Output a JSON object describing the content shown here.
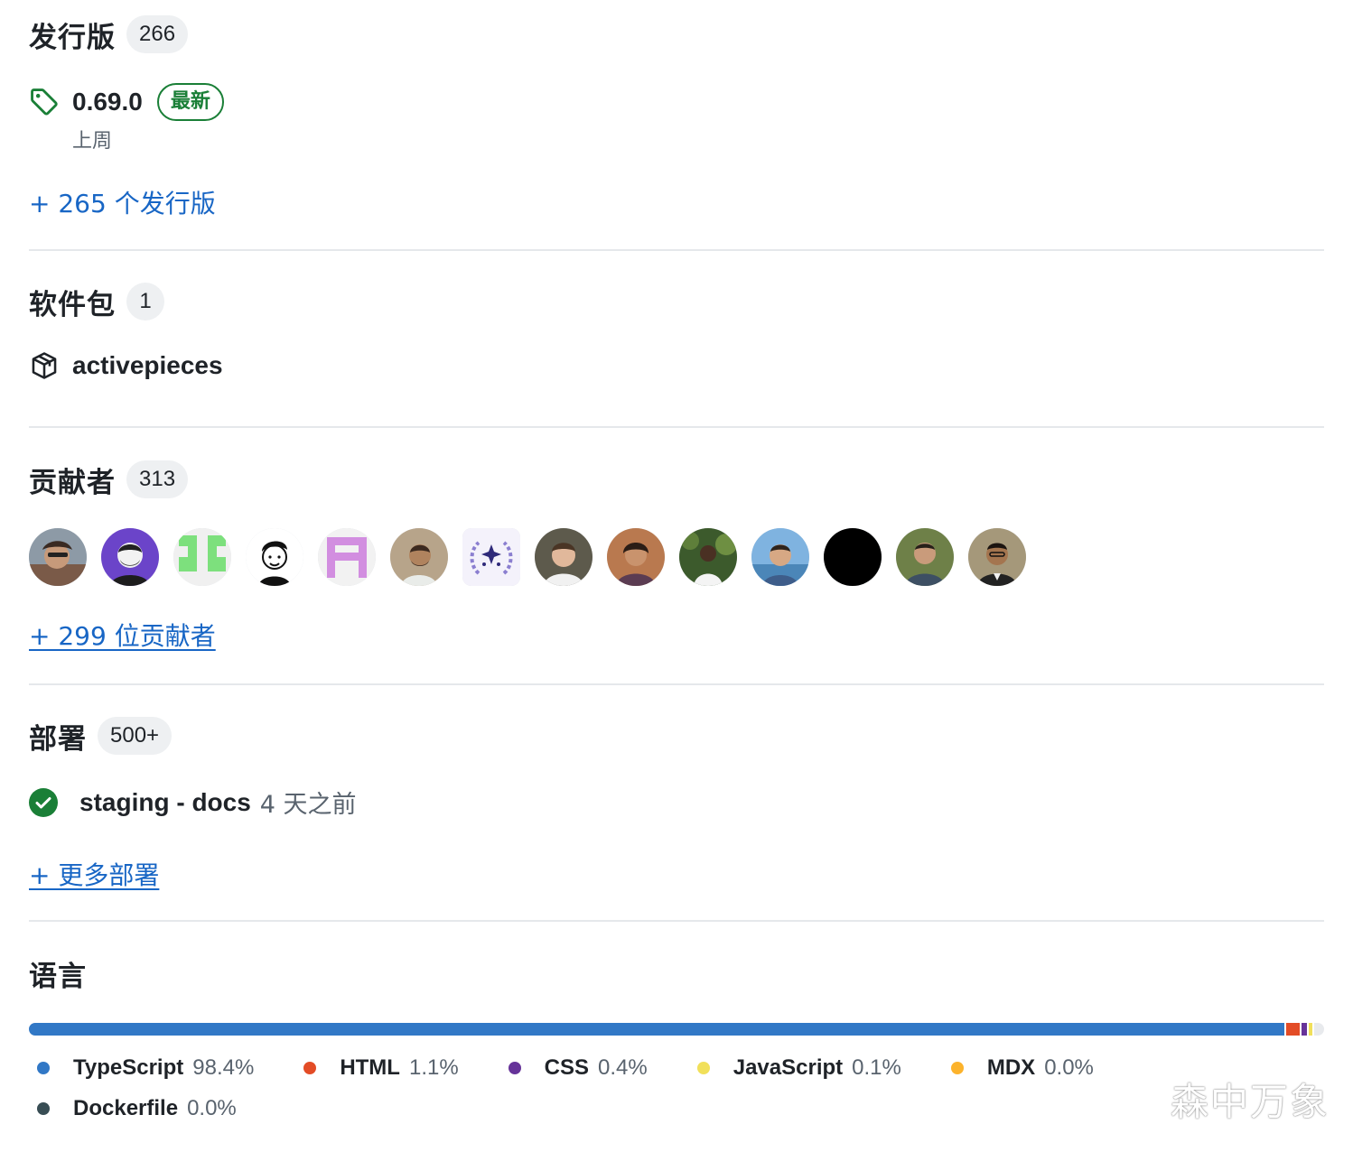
{
  "releases": {
    "title": "发行版",
    "count": "266",
    "latest": {
      "version": "0.69.0",
      "badge": "最新",
      "time": "上周"
    },
    "more_link": "+ 265 个发行版"
  },
  "packages": {
    "title": "软件包",
    "count": "1",
    "items": [
      {
        "name": "activepieces"
      }
    ]
  },
  "contributors": {
    "title": "贡献者",
    "count": "313",
    "avatar_count_shown": 14,
    "more_link": "+ 299 位贡献者"
  },
  "deployments": {
    "title": "部署",
    "count": "500+",
    "items": [
      {
        "env": "staging - docs",
        "time": "4 天之前",
        "status": "success"
      }
    ],
    "more_link": "+ 更多部署"
  },
  "languages": {
    "title": "语言",
    "items": [
      {
        "name": "TypeScript",
        "percent": "98.4%",
        "value": 98.4,
        "color": "#3178c6"
      },
      {
        "name": "HTML",
        "percent": "1.1%",
        "value": 1.1,
        "color": "#e34c26"
      },
      {
        "name": "CSS",
        "percent": "0.4%",
        "value": 0.4,
        "color": "#663399"
      },
      {
        "name": "JavaScript",
        "percent": "0.1%",
        "value": 0.1,
        "color": "#f1e05a"
      },
      {
        "name": "MDX",
        "percent": "0.0%",
        "value": 0.0,
        "color": "#fcb32c"
      },
      {
        "name": "Dockerfile",
        "percent": "0.0%",
        "value": 0.0,
        "color": "#384d54"
      }
    ]
  },
  "watermark": "森中万象"
}
